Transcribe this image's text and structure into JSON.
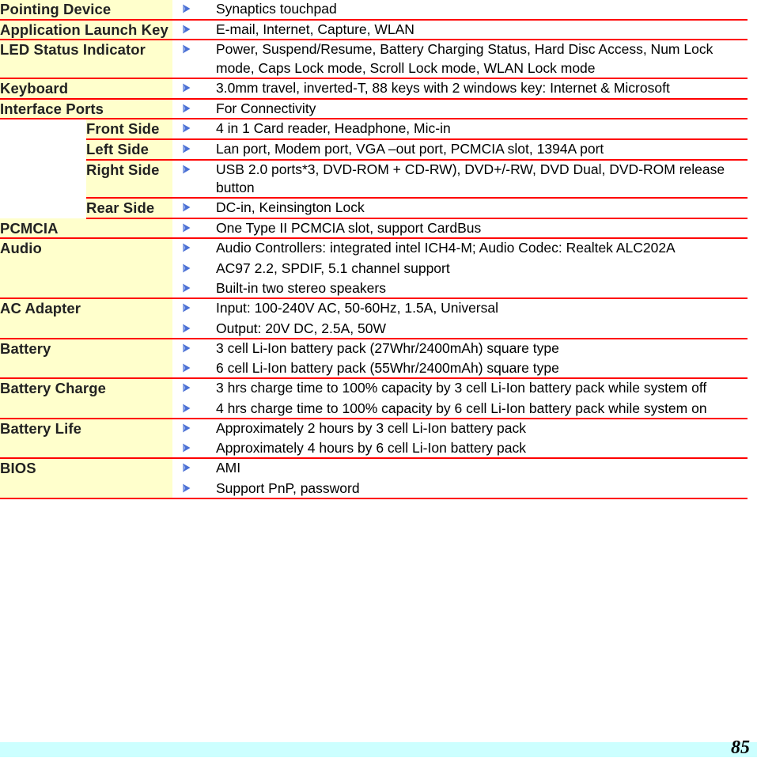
{
  "document": {
    "page_number": "85",
    "colors": {
      "label_background": "#ffffcc",
      "row_divider": "#ff0000",
      "bullet": "#4a6fd4",
      "footer_band": "#ccffff"
    },
    "bullet_icon": "right-arrowhead-bullet"
  },
  "table": {
    "rows": [
      {
        "label": "Pointing Device",
        "indented": false,
        "items": [
          "Synaptics touchpad"
        ]
      },
      {
        "label": "Application Launch Key",
        "indented": false,
        "items": [
          "E-mail, Internet, Capture, WLAN"
        ]
      },
      {
        "label": "LED Status Indicator",
        "indented": false,
        "items": [
          "Power, Suspend/Resume, Battery Charging Status, Hard Disc Access, Num Lock mode, Caps Lock mode, Scroll Lock mode, WLAN Lock mode"
        ]
      },
      {
        "label": "Keyboard",
        "indented": false,
        "items": [
          "3.0mm travel, inverted-T, 88 keys with 2 windows key: Internet & Microsoft"
        ]
      },
      {
        "label": "Interface Ports",
        "indented": false,
        "items": [
          "For Connectivity"
        ]
      },
      {
        "label": "Front Side",
        "indented": true,
        "items": [
          "4 in 1 Card reader, Headphone, Mic-in"
        ]
      },
      {
        "label": "Left Side",
        "indented": true,
        "items": [
          "Lan port, Modem port, VGA –out port, PCMCIA slot, 1394A port"
        ]
      },
      {
        "label": "Right Side",
        "indented": true,
        "items": [
          "USB 2.0 ports*3, DVD-ROM + CD-RW), DVD+/-RW, DVD Dual, DVD-ROM release button"
        ]
      },
      {
        "label": "Rear Side",
        "indented": true,
        "items": [
          "DC-in, Keinsington Lock"
        ]
      },
      {
        "label": "PCMCIA",
        "indented": false,
        "items": [
          "One Type II PCMCIA slot, support CardBus"
        ]
      },
      {
        "label": "Audio",
        "indented": false,
        "items": [
          "Audio Controllers: integrated intel ICH4-M; Audio Codec: Realtek ALC202A",
          "AC97 2.2, SPDIF, 5.1 channel support",
          "Built-in two stereo speakers"
        ]
      },
      {
        "label": "AC Adapter",
        "indented": false,
        "items": [
          "Input: 100-240V AC, 50-60Hz, 1.5A, Universal",
          "Output: 20V DC, 2.5A, 50W"
        ]
      },
      {
        "label": "Battery",
        "indented": false,
        "items": [
          "3 cell Li-Ion battery pack (27Whr/2400mAh) square type",
          "6 cell Li-Ion battery pack (55Whr/2400mAh) square type"
        ]
      },
      {
        "label": "Battery Charge",
        "indented": false,
        "items": [
          "3 hrs charge time to 100% capacity by 3 cell Li-Ion battery pack while system off",
          "4 hrs charge time to 100% capacity by 6 cell Li-Ion battery pack while system on"
        ]
      },
      {
        "label": "Battery Life",
        "indented": false,
        "items": [
          "Approximately 2 hours by 3 cell Li-Ion battery pack",
          "Approximately 4 hours by 6 cell Li-Ion battery pack"
        ]
      },
      {
        "label": "BIOS",
        "indented": false,
        "items": [
          "AMI",
          "Support PnP, password"
        ]
      }
    ]
  }
}
